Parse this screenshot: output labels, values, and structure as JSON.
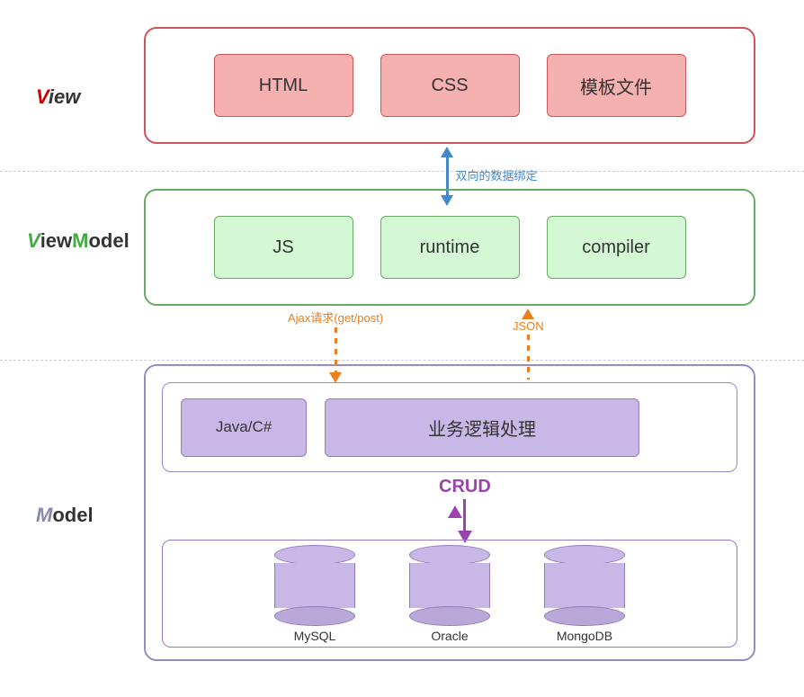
{
  "diagram": {
    "layers": {
      "view": {
        "label_v": "V",
        "label_rest": "iew",
        "items": [
          "HTML",
          "CSS",
          "模板文件"
        ]
      },
      "viewmodel": {
        "label_v": "V",
        "label_rest": "iew",
        "label_m": "M",
        "label_model_rest": "odel",
        "items": [
          "JS",
          "runtime",
          "compiler"
        ]
      },
      "model": {
        "label_m": "M",
        "label_rest": "odel",
        "business_items": [
          "Java/C#",
          "业务逻辑处理"
        ],
        "crud_label": "CRUD",
        "db_items": [
          "MySQL",
          "Oracle",
          "MongoDB"
        ]
      }
    },
    "arrows": {
      "double_label": "双向的数据绑定",
      "ajax_label": "Ajax请求(get/post)",
      "json_label": "JSON"
    }
  }
}
